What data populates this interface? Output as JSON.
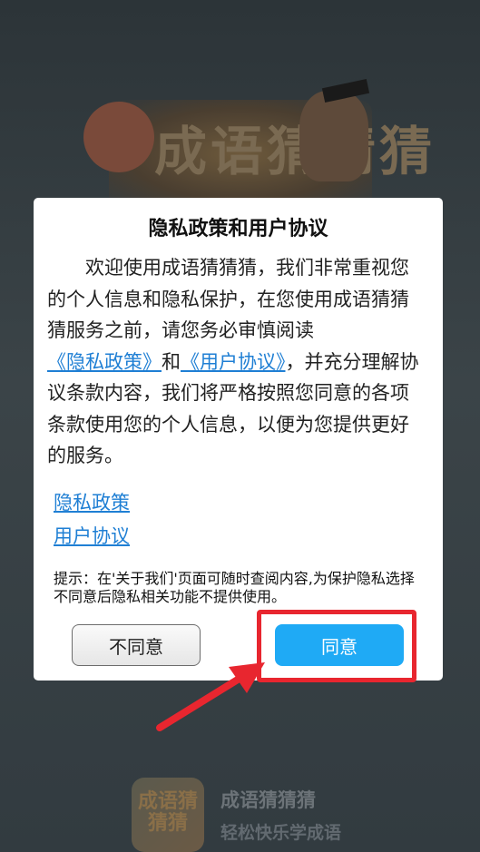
{
  "background": {
    "splash_title_art": "成语猜猜猜"
  },
  "dialog": {
    "title": "隐私政策和用户协议",
    "body": {
      "text_1": "欢迎使用成语猜猜猜，我们非常重视您的个人信息和隐私保护，在您使用成语猜猜猜服务之前，请您务必审慎阅读",
      "privacy_link": "《隐私政策》",
      "and": "和",
      "agreement_link": "《用户协议》",
      "text_2": "，并充分理解协议条款内容，我们将严格按照您同意的各项条款使用您的个人信息，以便为您提供更好的服务。"
    },
    "links": {
      "privacy_policy": "隐私政策",
      "user_agreement": "用户协议"
    },
    "hint": "提示：在'关于我们'页面可随时查阅内容,为保护隐私选择不同意后隐私相关功能不提供使用。",
    "buttons": {
      "decline": "不同意",
      "agree": "同意"
    }
  },
  "app": {
    "icon_text": "成语猜猜猜",
    "name": "成语猜猜猜",
    "slogan": "轻松快乐学成语"
  },
  "colors": {
    "agree_button": "#1faaf5",
    "link": "#1f7fd4",
    "highlight": "#e8262f"
  }
}
